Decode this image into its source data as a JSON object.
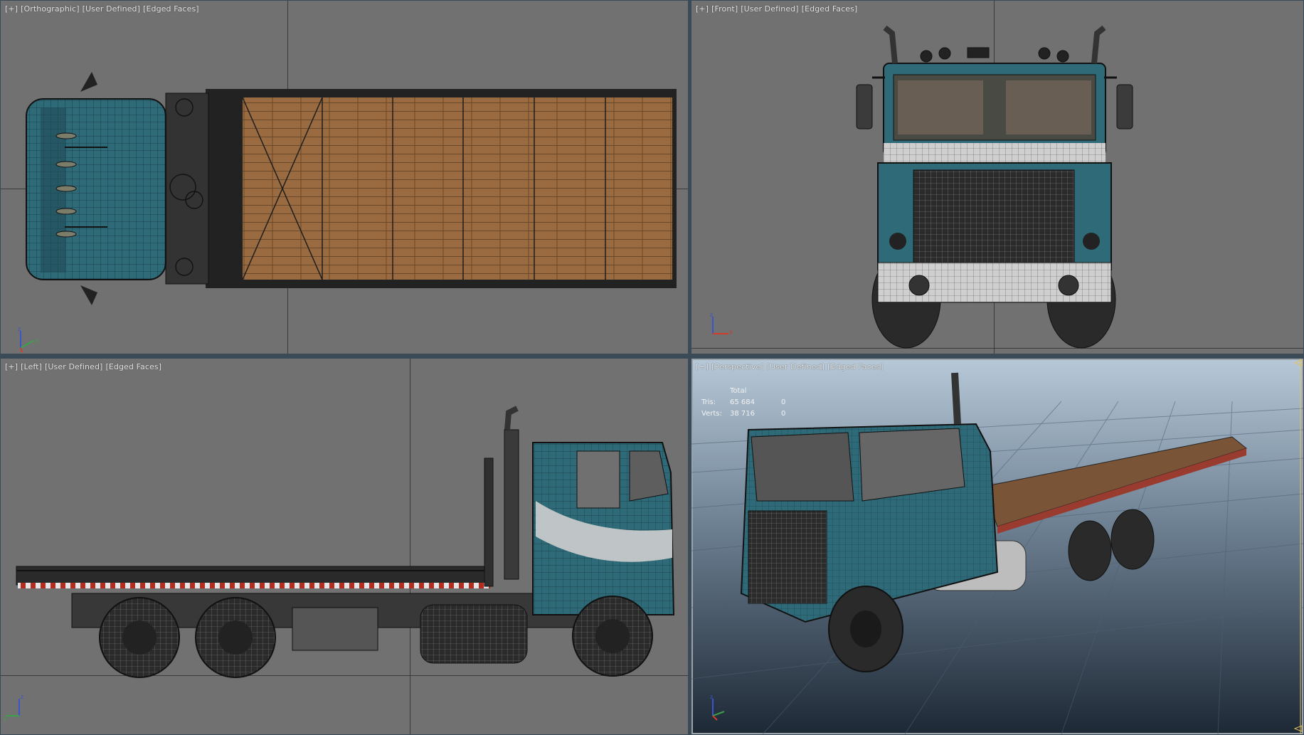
{
  "viewports": {
    "top": {
      "plus": "[+]",
      "view": "[Orthographic]",
      "shading": "[User Defined]",
      "edges": "[Edged Faces]"
    },
    "front": {
      "plus": "[+]",
      "view": "[Front]",
      "shading": "[User Defined]",
      "edges": "[Edged Faces]"
    },
    "left": {
      "plus": "[+]",
      "view": "[Left]",
      "shading": "[User Defined]",
      "edges": "[Edged Faces]"
    },
    "perspective": {
      "plus": "[+]",
      "view": "[Perspective]",
      "shading": "[User Defined]",
      "edges": "[Edged Faces]"
    }
  },
  "stats": {
    "header": "Total",
    "rows": [
      {
        "label": "Tris:",
        "total": "65 684",
        "selected": "0"
      },
      {
        "label": "Verts:",
        "total": "38 716",
        "selected": "0"
      }
    ]
  },
  "axes": {
    "x": "x",
    "y": "y",
    "z": "z"
  },
  "colors": {
    "viewport_bg": "#717171",
    "cab_teal": "#2e6a78",
    "wood": "#9a6a40",
    "wire": "#1f1f1f",
    "axis_x": "#d33b2b",
    "axis_y": "#3aa34a",
    "axis_z": "#3a56c9",
    "persp_top": "#b7c9d8",
    "persp_bottom": "#1d2835"
  }
}
